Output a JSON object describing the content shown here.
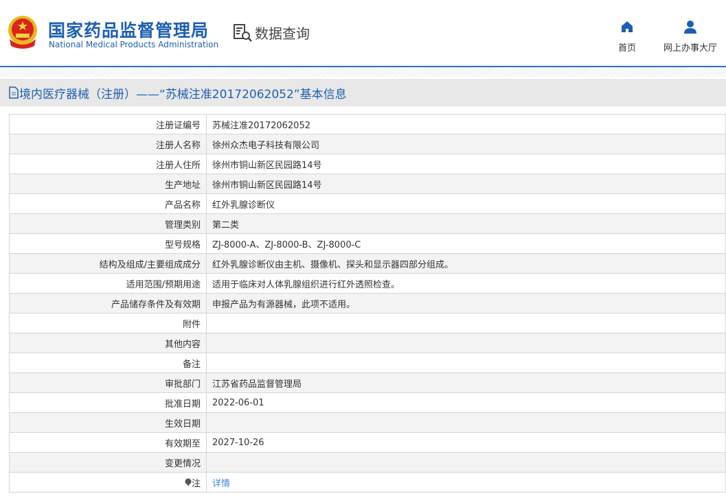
{
  "header": {
    "org_cn": "国家药品监督管理局",
    "org_en": "National Medical Products Administration",
    "query_label": "数据查询",
    "nav": [
      {
        "label": "首页",
        "icon": "home-icon"
      },
      {
        "label": "网上办事大厅",
        "icon": "user-icon"
      }
    ]
  },
  "title": "境内医疗器械（注册）——“苏械注准20172062052”基本信息",
  "rows": [
    {
      "k": "注册证编号",
      "v": "苏械注准20172062052"
    },
    {
      "k": "注册人名称",
      "v": "徐州众杰电子科技有限公司"
    },
    {
      "k": "注册人住所",
      "v": "徐州市铜山新区民园路14号"
    },
    {
      "k": "生产地址",
      "v": "徐州市铜山新区民园路14号"
    },
    {
      "k": "产品名称",
      "v": "红外乳腺诊断仪"
    },
    {
      "k": "管理类别",
      "v": "第二类"
    },
    {
      "k": "型号规格",
      "v": "ZJ-8000-A、ZJ-8000-B、ZJ-8000-C"
    },
    {
      "k": "结构及组成/主要组成成分",
      "v": "红外乳腺诊断仪由主机、摄像机、探头和显示器四部分组成。"
    },
    {
      "k": "适用范围/预期用途",
      "v": "适用于临床对人体乳腺组织进行红外透照检查。"
    },
    {
      "k": "产品储存条件及有效期",
      "v": "申报产品为有源器械，此项不适用。"
    },
    {
      "k": "附件",
      "v": ""
    },
    {
      "k": "其他内容",
      "v": ""
    },
    {
      "k": "备注",
      "v": ""
    },
    {
      "k": "审批部门",
      "v": "江苏省药品监督管理局"
    },
    {
      "k": "批准日期",
      "v": "2022-06-01"
    },
    {
      "k": "生效日期",
      "v": ""
    },
    {
      "k": "有效期至",
      "v": "2027-10-26"
    },
    {
      "k": "变更情况",
      "v": ""
    }
  ],
  "note": {
    "label": "注",
    "link": "详情"
  },
  "colors": {
    "brand": "#1f5fb0",
    "link": "#3a8ad6"
  }
}
